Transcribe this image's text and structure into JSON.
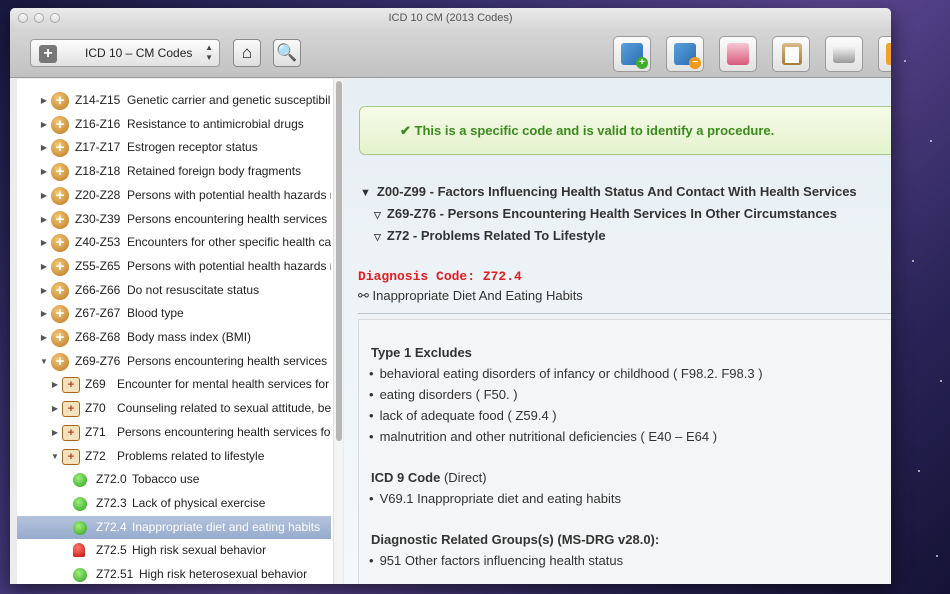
{
  "window": {
    "title": "ICD 10 CM (2013 Codes)"
  },
  "toolbar": {
    "code_set": "ICD 10 – CM Codes",
    "home_icon": "home-icon",
    "search_icon": "magnifier-icon",
    "action_icons": [
      "bookmark-add-icon",
      "bookmark-remove-icon",
      "mail-icon",
      "clipboard-icon",
      "print-icon",
      "settings-icon"
    ]
  },
  "sidebar": {
    "items": [
      {
        "code": "Z14-Z15",
        "label": "Genetic carrier and genetic susceptibility t",
        "kind": "category",
        "disclosure": "▶"
      },
      {
        "code": "Z16-Z16",
        "label": "Resistance to antimicrobial drugs",
        "kind": "category",
        "disclosure": "▶"
      },
      {
        "code": "Z17-Z17",
        "label": "Estrogen receptor status",
        "kind": "category",
        "disclosure": "▶"
      },
      {
        "code": "Z18-Z18",
        "label": "Retained foreign body fragments",
        "kind": "category",
        "disclosure": "▶"
      },
      {
        "code": "Z20-Z28",
        "label": "Persons with potential health hazards rela",
        "kind": "category",
        "disclosure": "▶"
      },
      {
        "code": "Z30-Z39",
        "label": "Persons encountering health services in ci",
        "kind": "category",
        "disclosure": "▶"
      },
      {
        "code": "Z40-Z53",
        "label": "Encounters for other specific health care",
        "kind": "category",
        "disclosure": "▶"
      },
      {
        "code": "Z55-Z65",
        "label": "Persons with potential health hazards rela",
        "kind": "category",
        "disclosure": "▶"
      },
      {
        "code": "Z66-Z66",
        "label": "Do not resuscitate status",
        "kind": "category",
        "disclosure": "▶"
      },
      {
        "code": "Z67-Z67",
        "label": "Blood type",
        "kind": "category",
        "disclosure": "▶"
      },
      {
        "code": "Z68-Z68",
        "label": "Body mass index (BMI)",
        "kind": "category",
        "disclosure": "▶"
      },
      {
        "code": "Z69-Z76",
        "label": "Persons encountering health services in ot",
        "kind": "category",
        "disclosure": "▼"
      },
      {
        "code": "Z69",
        "label": "Encounter for mental health services for victi",
        "kind": "group",
        "disclosure": "▶"
      },
      {
        "code": "Z70",
        "label": "Counseling related to sexual attitude, behavi",
        "kind": "group",
        "disclosure": "▶"
      },
      {
        "code": "Z71",
        "label": "Persons encountering health services for oth",
        "kind": "group",
        "disclosure": "▶"
      },
      {
        "code": "Z72",
        "label": "Problems related to lifestyle",
        "kind": "group",
        "disclosure": "▼"
      },
      {
        "code": "Z72.0",
        "label": "Tobacco use",
        "kind": "leaf",
        "disclosure": ""
      },
      {
        "code": "Z72.3",
        "label": "Lack of physical exercise",
        "kind": "leaf",
        "disclosure": ""
      },
      {
        "code": "Z72.4",
        "label": "Inappropriate diet and eating habits",
        "kind": "leaf",
        "disclosure": "",
        "selected": true
      },
      {
        "code": "Z72.5",
        "label": "High risk sexual behavior",
        "kind": "alert",
        "disclosure": ""
      },
      {
        "code": "Z72.51",
        "label": "High risk heterosexual behavior",
        "kind": "leaf",
        "disclosure": ""
      }
    ]
  },
  "detail": {
    "valid_banner": "✔ This is a specific code and is valid to identify a procedure.",
    "hierarchy": [
      {
        "marker": "▼",
        "text": "Z00-Z99 - Factors Influencing Health Status And Contact With Health Services"
      },
      {
        "marker": "▽",
        "text": "Z69-Z76 - Persons Encountering Health Services In Other Circumstances"
      },
      {
        "marker": "▽",
        "text": "Z72 - Problems Related To Lifestyle"
      }
    ],
    "diagnosis_label": "Diagnosis Code: Z72.4",
    "diagnosis_desc": "⚯ Inappropriate Diet And Eating Habits",
    "type1_title": "Type 1 Excludes",
    "type1_items": [
      "behavioral eating disorders of infancy or childhood ( F98.2. F98.3 )",
      "eating disorders ( F50. )",
      "lack of adequate food ( Z59.4 )",
      "malnutrition and other nutritional deficiencies ( E40 – E64 )"
    ],
    "icd9_title": "ICD 9 Code",
    "icd9_sub": "(Direct)",
    "icd9_items": [
      "V69.1 Inappropriate diet and eating habits"
    ],
    "drg_title": "Diagnostic Related Groups(s) (MS-DRG v28.0):",
    "drg_items": [
      "951 Other factors influencing health status"
    ]
  }
}
